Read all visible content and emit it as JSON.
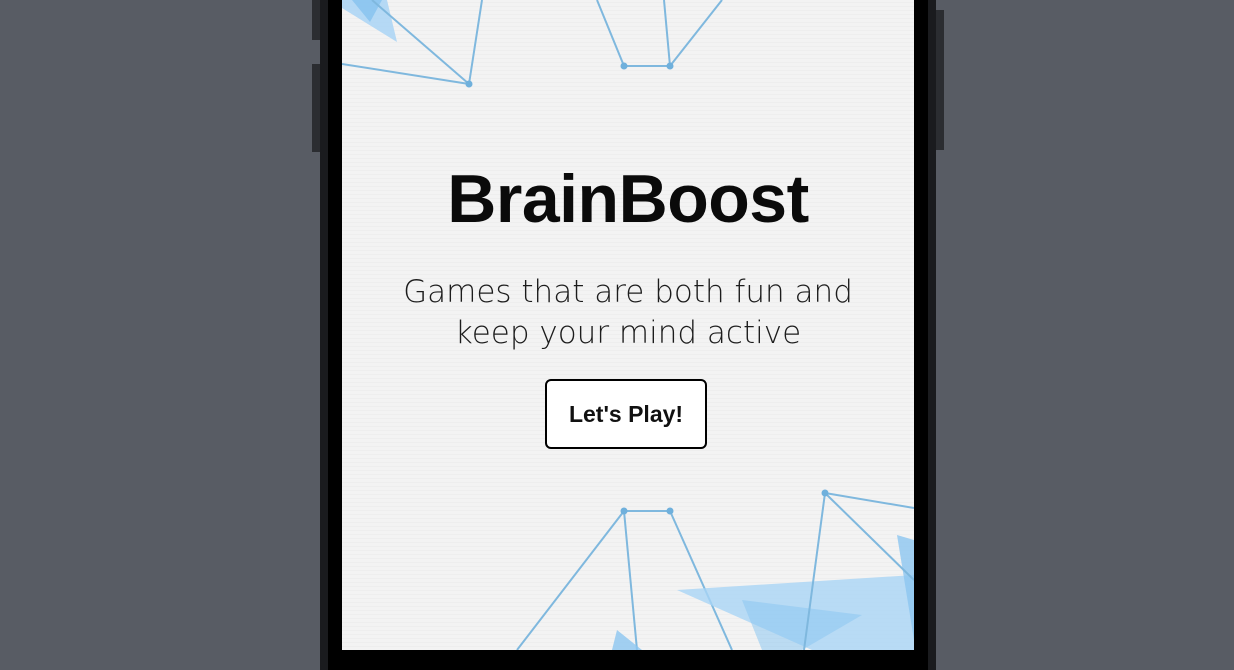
{
  "app": {
    "title": "BrainBoost",
    "subtitle": "Games that are both fun and keep your mind active",
    "cta_label": "Let's Play!"
  },
  "colors": {
    "background": "#585c64",
    "screen": "#f2f2f2",
    "accent_line": "#7fb8de",
    "accent_fill": "#a9d4f5",
    "text": "#0a0a0a"
  }
}
